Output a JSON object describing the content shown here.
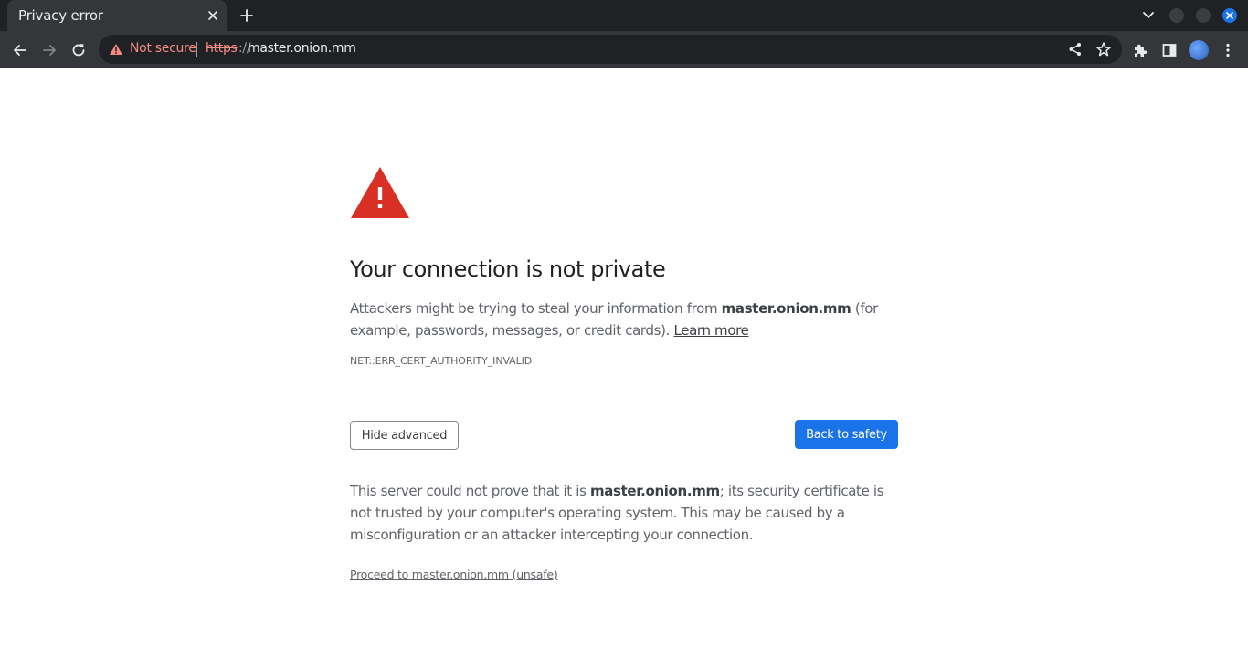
{
  "tab": {
    "title": "Privacy error"
  },
  "omnibox": {
    "security_label": "Not secure",
    "scheme": "https",
    "scheme_separator": "://",
    "host": "master.onion.mm"
  },
  "colors": {
    "accent": "#1a73e8",
    "warning_red": "#d93025",
    "omnibox_warning": "#f28b82"
  },
  "icons": [
    "close-icon",
    "plus-icon",
    "chevron-down-icon",
    "back-arrow-icon",
    "forward-arrow-icon",
    "reload-icon",
    "warning-icon",
    "share-icon",
    "star-icon",
    "extensions-icon",
    "side-panel-icon",
    "kebab-menu-icon"
  ],
  "page": {
    "heading": "Your connection is not private",
    "explanation_prefix": "Attackers might be trying to steal your information from ",
    "explanation_host": "master.onion.mm",
    "explanation_suffix": " (for example, passwords, messages, or credit cards). ",
    "learn_more": "Learn more",
    "error_code": "NET::ERR_CERT_AUTHORITY_INVALID",
    "hide_advanced": "Hide advanced",
    "back_to_safety": "Back to safety",
    "details_prefix": "This server could not prove that it is ",
    "details_host": "master.onion.mm",
    "details_suffix": "; its security certificate is not trusted by your computer's operating system. This may be caused by a misconfiguration or an attacker intercepting your connection.",
    "proceed_link": "Proceed to master.onion.mm (unsafe)"
  }
}
